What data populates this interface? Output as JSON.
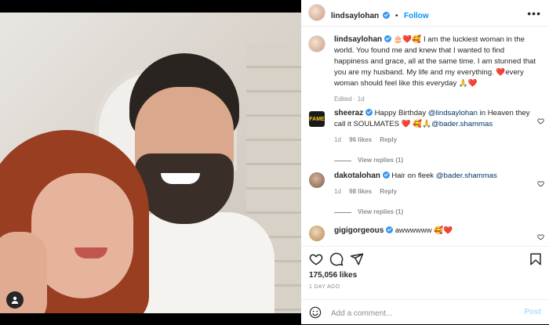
{
  "header": {
    "username": "lindsaylohan",
    "follow": "Follow",
    "separator": "•"
  },
  "caption": {
    "username": "lindsaylohan",
    "emojis": "🎂❤️🥰",
    "text": " I am the luckiest woman in the world. You found me and knew that I wanted to find happiness and grace, all at the same time. I am stunned that you are my husband. My life and my everything. ",
    "heart": "❤️",
    "text2": "every woman should feel like this everyday ",
    "emojis2": "🙏❤️",
    "meta": "Edited · 1d"
  },
  "comments": [
    {
      "username": "sheeraz",
      "pre": "Happy Birthday ",
      "mention": "@lindsaylohan",
      "post": " in Heaven they call it SOULMATES ",
      "emojis": "❤️ 🥰🙏",
      "mention2": "@bader.shammas",
      "age": "1d",
      "likes": "96 likes",
      "reply": "Reply",
      "view_replies": "View replies (1)"
    },
    {
      "username": "dakotalohan",
      "pre": "Hair on fleek ",
      "mention": "@bader.shammas",
      "age": "1d",
      "likes": "98 likes",
      "reply": "Reply",
      "view_replies": "View replies (1)"
    },
    {
      "username": "gigigorgeous",
      "pre": "awwwwww ",
      "emojis": "🥰❤️"
    }
  ],
  "stats": {
    "likes": "175,056 likes",
    "ago": "1 DAY AGO"
  },
  "add_comment": {
    "placeholder": "Add a comment...",
    "post": "Post"
  },
  "icons": [
    "more-options-icon",
    "verified-badge-icon",
    "heart-icon",
    "comment-icon",
    "share-icon",
    "bookmark-icon",
    "emoji-icon",
    "tag-user-icon"
  ],
  "colors": {
    "link": "#0095f6",
    "mention": "#00376b",
    "muted": "#8e8e8e",
    "verified": "#3897f0"
  }
}
